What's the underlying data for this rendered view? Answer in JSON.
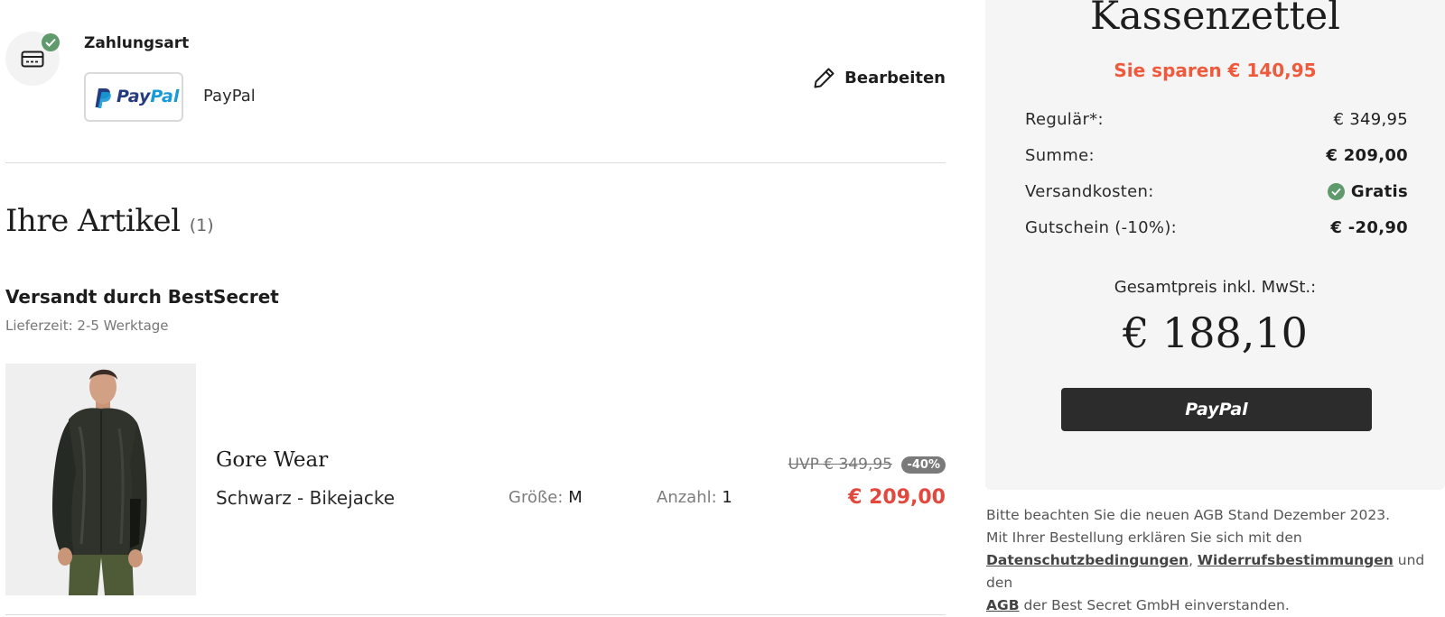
{
  "payment": {
    "title": "Zahlungsart",
    "method_label": "PayPal",
    "logo_pay": "Pay",
    "logo_pal": "Pal",
    "edit_label": "Bearbeiten"
  },
  "items": {
    "title": "Ihre Artikel",
    "count": "(1)",
    "shipped_by": "Versandt durch BestSecret",
    "delivery": "Lieferzeit: 2-5 Werktage",
    "list": [
      {
        "brand": "Gore Wear",
        "name": "Schwarz - Bikejacke",
        "size_label": "Größe:",
        "size_value": "M",
        "qty_label": "Anzahl:",
        "qty_value": "1",
        "uvp": "UVP € 349,95",
        "discount": "-40%",
        "price": "€ 209,00"
      }
    ]
  },
  "summary": {
    "title": "Kassenzettel",
    "savings": "Sie sparen € 140,95",
    "rows": [
      {
        "label": "Regulär*:",
        "value": "€ 349,95"
      },
      {
        "label": "Summe:",
        "value": "€ 209,00"
      },
      {
        "label": "Versandkosten:",
        "value": "Gratis"
      },
      {
        "label": "Gutschein (-10%):",
        "value": "€ -20,90"
      }
    ],
    "total_label": "Gesamtpreis inkl. MwSt.:",
    "total_value": "€ 188,10",
    "pay_button": "PayPal"
  },
  "legal": {
    "line1": "Bitte beachten Sie die neuen AGB Stand Dezember 2023.",
    "line2": "Mit Ihrer Bestellung erklären Sie sich mit den",
    "link_privacy": "Datenschutzbedingungen",
    "sep": ", ",
    "link_withdrawal": "Widerrufsbestimmungen",
    "and": " und den",
    "link_agb": "AGB",
    "tail": " der Best Secret GmbH einverstanden."
  },
  "colors": {
    "accent_red": "#e2483d",
    "savings_orange": "#ef5a3c",
    "success_green": "#5e9a6b",
    "paypal_dark": "#253b80",
    "paypal_light": "#179bd7",
    "button_dark": "#2c2c2c"
  },
  "icons": {
    "payment": "credit-card-icon",
    "done": "check-icon",
    "edit": "pencil-icon"
  }
}
